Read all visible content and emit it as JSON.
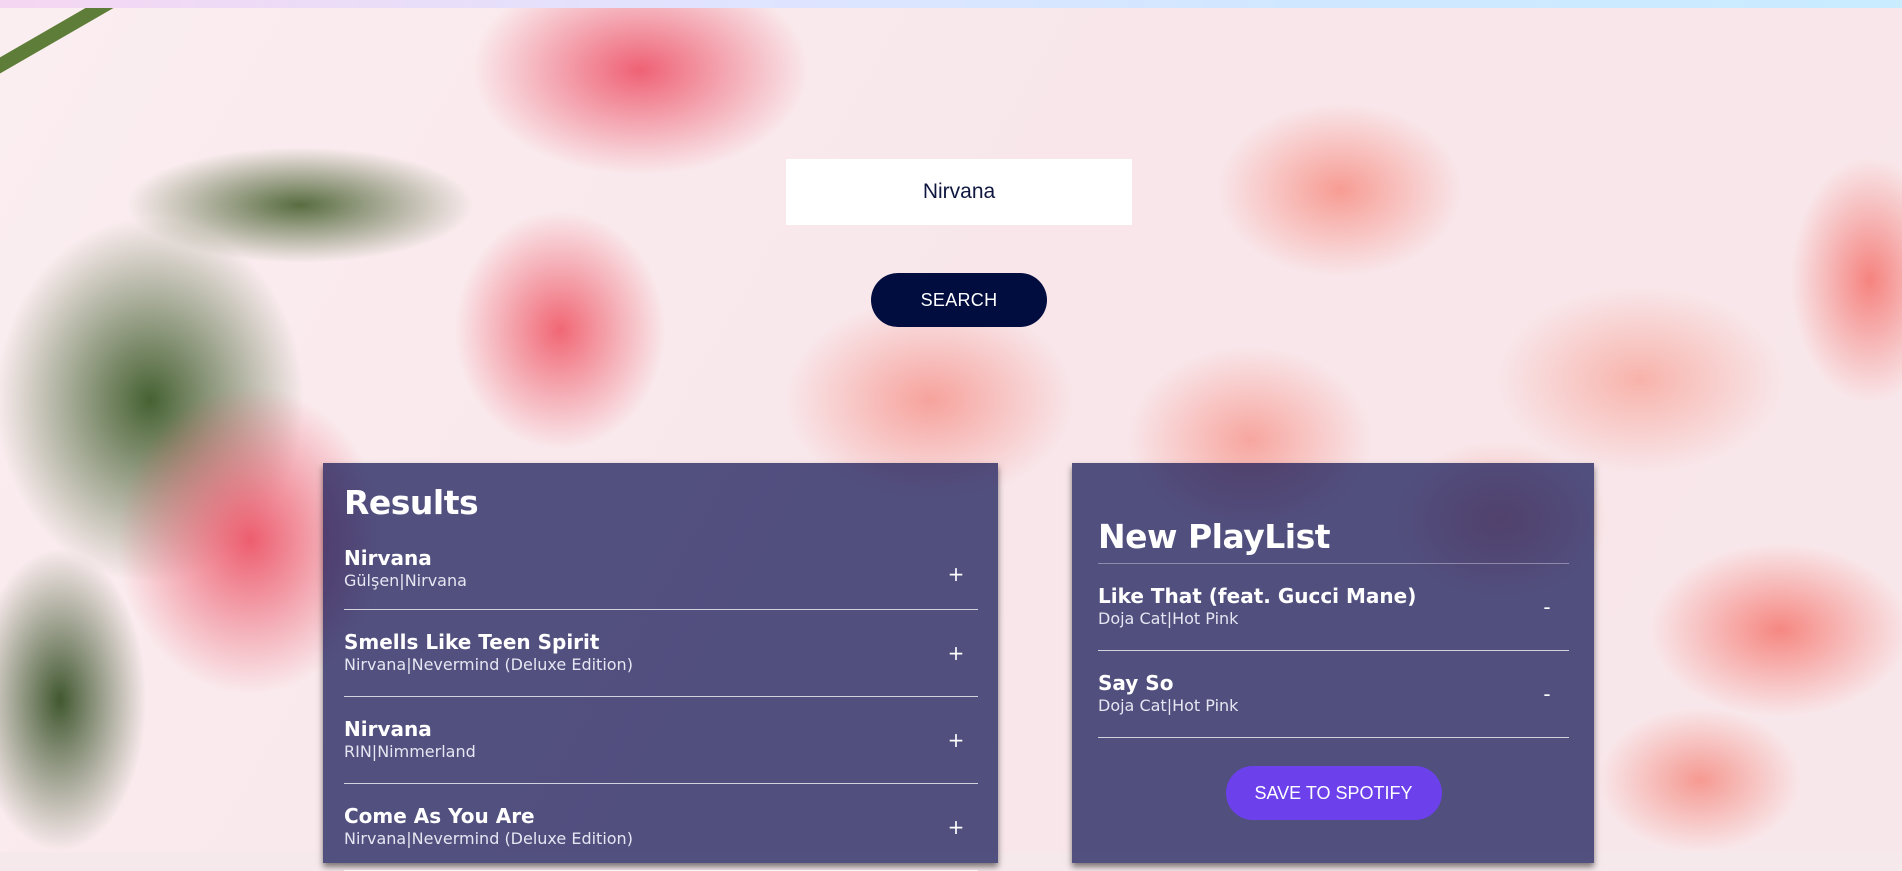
{
  "search": {
    "value": "Nirvana",
    "button_label": "SEARCH"
  },
  "results": {
    "title": "Results",
    "tracks": [
      {
        "name": "Nirvana",
        "artist_album": "Gülşen|Nirvana",
        "action": "+"
      },
      {
        "name": "Smells Like Teen Spirit",
        "artist_album": "Nirvana|Nevermind (Deluxe Edition)",
        "action": "+"
      },
      {
        "name": "Nirvana",
        "artist_album": "RIN|Nimmerland",
        "action": "+"
      },
      {
        "name": "Come As You Are",
        "artist_album": "Nirvana|Nevermind (Deluxe Edition)",
        "action": "+"
      }
    ]
  },
  "playlist": {
    "title": "New PlayList",
    "tracks": [
      {
        "name": "Like That (feat. Gucci Mane)",
        "artist_album": "Doja Cat|Hot Pink",
        "action": "-"
      },
      {
        "name": "Say So",
        "artist_album": "Doja Cat|Hot Pink",
        "action": "-"
      }
    ],
    "save_label": "SAVE TO SPOTIFY"
  },
  "colors": {
    "search_button": "#010c3f",
    "save_button": "#6c41ec",
    "panel_background": "#101555"
  }
}
